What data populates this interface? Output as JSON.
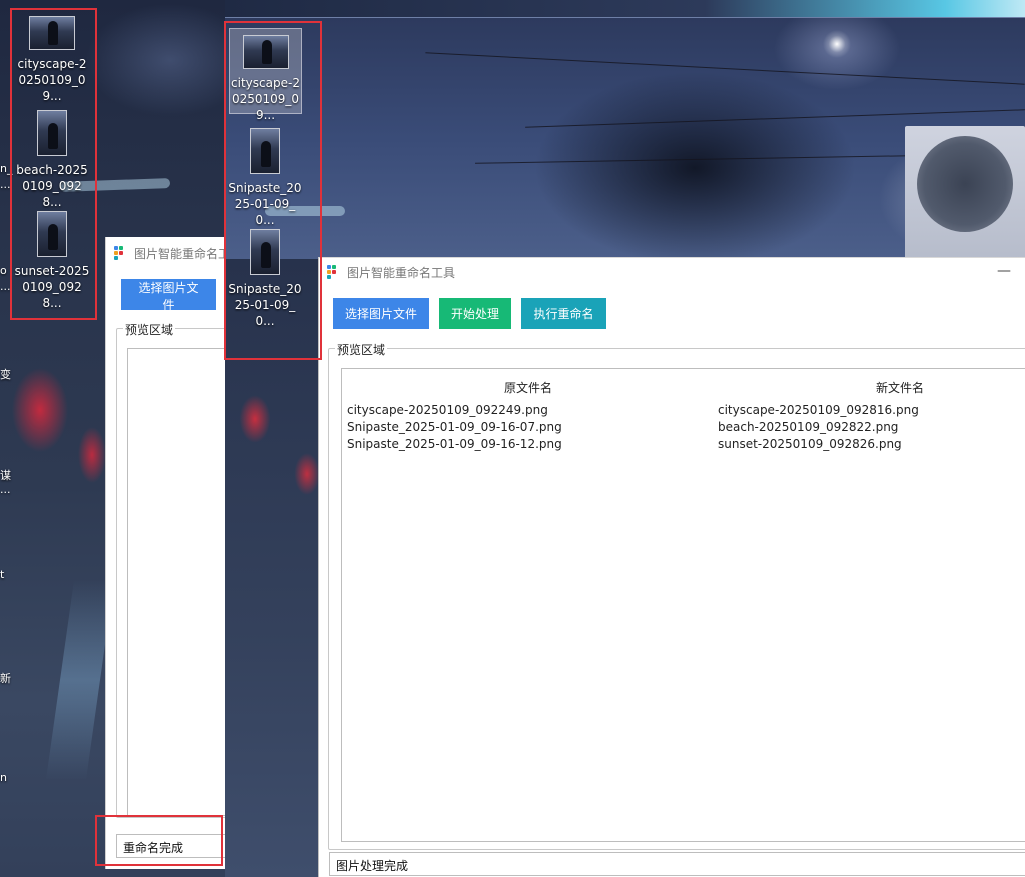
{
  "desktop_icons_left": [
    {
      "name": "cityscape-20250109_09..."
    },
    {
      "name": "beach-20250109_0928..."
    },
    {
      "name": "sunset-20250109_0928..."
    }
  ],
  "desktop_icons_right": [
    {
      "name": "cityscape-20250109_09..."
    },
    {
      "name": "Snipaste_2025-01-09_0..."
    },
    {
      "name": "Snipaste_2025-01-09_0..."
    }
  ],
  "edge_labels": [
    "n_",
    "...",
    "o",
    "...",
    "变",
    "谋",
    "...",
    "t",
    "新",
    "n"
  ],
  "window_back": {
    "title": "图片智能重命名工具",
    "select_button": "选择图片文件",
    "preview_label": "预览区域",
    "status": "重命名完成"
  },
  "window_main": {
    "title": "图片智能重命名工具",
    "minimize": "—",
    "buttons": {
      "select": "选择图片文件",
      "process": "开始处理",
      "rename": "执行重命名"
    },
    "preview_label": "预览区域",
    "columns": {
      "original": "原文件名",
      "new": "新文件名"
    },
    "rows": [
      {
        "original": "cityscape-20250109_092249.png",
        "new": "cityscape-20250109_092816.png"
      },
      {
        "original": "Snipaste_2025-01-09_09-16-07.png",
        "new": "beach-20250109_092822.png"
      },
      {
        "original": "Snipaste_2025-01-09_09-16-12.png",
        "new": "sunset-20250109_092826.png"
      }
    ],
    "status": "图片处理完成"
  },
  "colors": {
    "highlight_box": "#e0323a",
    "btn_blue": "#3d86e8",
    "btn_green": "#17b976",
    "btn_teal": "#1aa3b8"
  }
}
